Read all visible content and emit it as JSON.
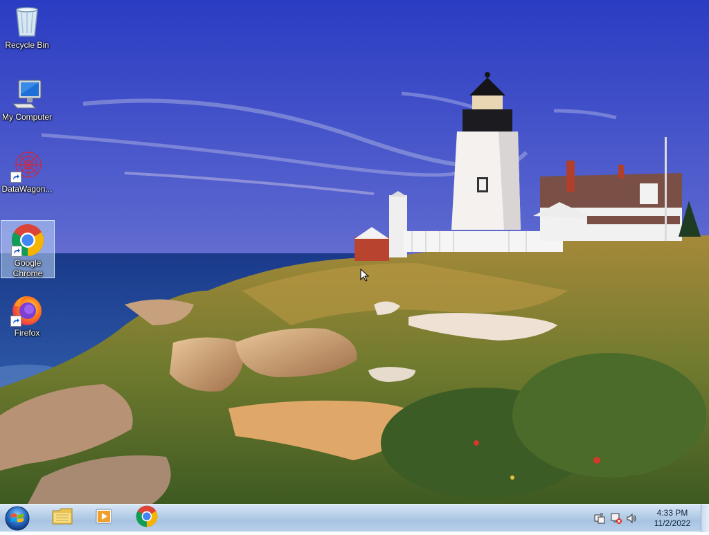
{
  "desktop": {
    "icons": [
      {
        "label": "Recycle Bin",
        "icon": "recycle-bin-icon"
      },
      {
        "label": "My Computer",
        "icon": "computer-icon"
      },
      {
        "label": "DataWagon...",
        "icon": "datawagon-icon"
      },
      {
        "label": "Google Chrome",
        "icon": "chrome-icon"
      },
      {
        "label": "Firefox",
        "icon": "firefox-icon"
      }
    ],
    "selected_icon": "Google Chrome"
  },
  "taskbar": {
    "pinned": [
      {
        "name": "File Explorer",
        "icon": "folder-icon"
      },
      {
        "name": "Windows Media Player",
        "icon": "media-player-icon"
      },
      {
        "name": "Google Chrome",
        "icon": "chrome-icon"
      }
    ],
    "tray": {
      "icons": [
        "action-center-icon",
        "network-icon",
        "volume-icon"
      ],
      "time": "4:33 PM",
      "date": "11/2/2022"
    }
  },
  "colors": {
    "taskbar": "#b7cfe8",
    "selection": "#cfe3f7",
    "sky_top": "#2c3fc4",
    "sea": "#1c3f8e"
  }
}
